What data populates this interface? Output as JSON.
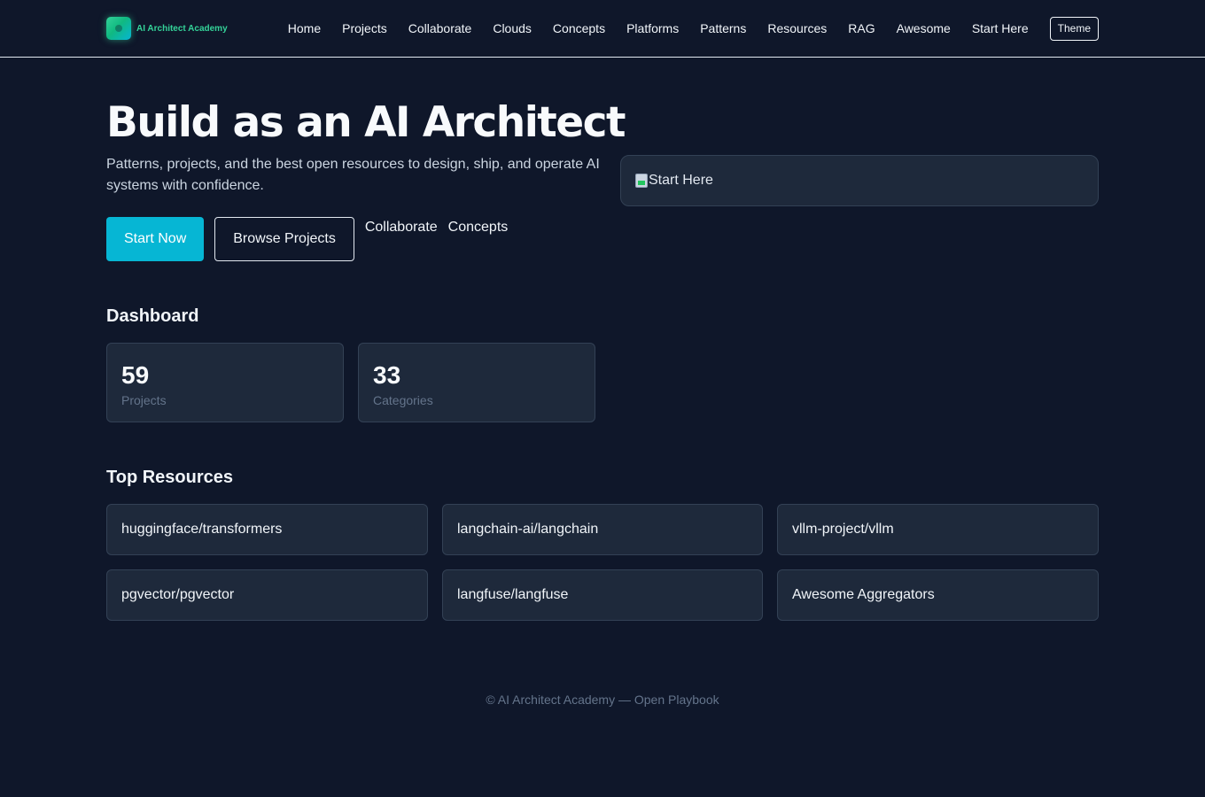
{
  "brand": {
    "name": "AI Architect Academy"
  },
  "nav": {
    "items": [
      "Home",
      "Projects",
      "Collaborate",
      "Clouds",
      "Concepts",
      "Platforms",
      "Patterns",
      "Resources",
      "RAG",
      "Awesome",
      "Start Here"
    ],
    "theme_label": "Theme"
  },
  "hero": {
    "title": "Build as an AI Architect",
    "subtitle": "Patterns, projects, and the best open resources to design, ship, and operate AI systems with confidence.",
    "primary_cta": "Start Now",
    "secondary_cta": "Browse Projects",
    "links": [
      "Collaborate",
      "Concepts"
    ],
    "image_alt": "Start Here"
  },
  "dashboard": {
    "title": "Dashboard",
    "stats": [
      {
        "value": "59",
        "label": "Projects"
      },
      {
        "value": "33",
        "label": "Categories"
      }
    ]
  },
  "resources": {
    "title": "Top Resources",
    "items": [
      "huggingface/transformers",
      "langchain-ai/langchain",
      "vllm-project/vllm",
      "pgvector/pgvector",
      "langfuse/langfuse",
      "Awesome Aggregators"
    ]
  },
  "footer": {
    "text": "© AI Architect Academy — Open Playbook"
  },
  "colors": {
    "background": "#0f172a",
    "accent": "#06b6d4",
    "brand": "#34d399",
    "card": "#1e293b"
  }
}
